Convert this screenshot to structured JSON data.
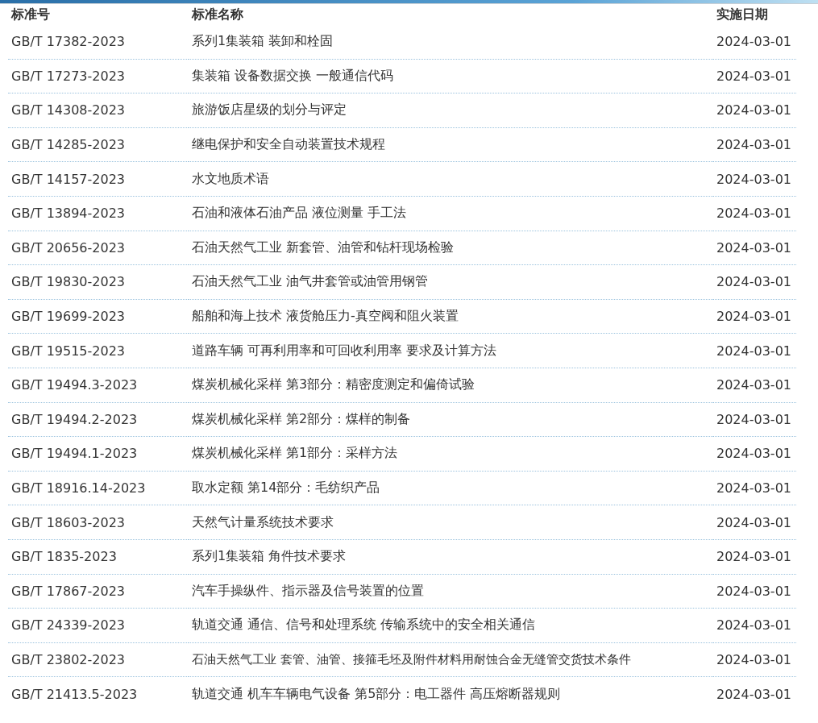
{
  "table": {
    "columns": [
      "标准号",
      "标准名称",
      "实施日期"
    ],
    "rows": [
      {
        "code": "GB/T 17382-2023",
        "name": "系列1集装箱 装卸和栓固",
        "date": "2024-03-01"
      },
      {
        "code": "GB/T 17273-2023",
        "name": "集装箱 设备数据交换 一般通信代码",
        "date": "2024-03-01"
      },
      {
        "code": "GB/T 14308-2023",
        "name": "旅游饭店星级的划分与评定",
        "date": "2024-03-01"
      },
      {
        "code": "GB/T 14285-2023",
        "name": "继电保护和安全自动装置技术规程",
        "date": "2024-03-01"
      },
      {
        "code": "GB/T 14157-2023",
        "name": "水文地质术语",
        "date": "2024-03-01"
      },
      {
        "code": "GB/T 13894-2023",
        "name": "石油和液体石油产品 液位测量 手工法",
        "date": "2024-03-01"
      },
      {
        "code": "GB/T 20656-2023",
        "name": "石油天然气工业 新套管、油管和钻杆现场检验",
        "date": "2024-03-01"
      },
      {
        "code": "GB/T 19830-2023",
        "name": "石油天然气工业 油气井套管或油管用钢管",
        "date": "2024-03-01"
      },
      {
        "code": "GB/T 19699-2023",
        "name": "船舶和海上技术 液货舱压力-真空阀和阻火装置",
        "date": "2024-03-01"
      },
      {
        "code": "GB/T 19515-2023",
        "name": "道路车辆 可再利用率和可回收利用率 要求及计算方法",
        "date": "2024-03-01"
      },
      {
        "code": "GB/T 19494.3-2023",
        "name": "煤炭机械化采样 第3部分：精密度测定和偏倚试验",
        "date": "2024-03-01"
      },
      {
        "code": "GB/T 19494.2-2023",
        "name": "煤炭机械化采样 第2部分：煤样的制备",
        "date": "2024-03-01"
      },
      {
        "code": "GB/T 19494.1-2023",
        "name": "煤炭机械化采样 第1部分：采样方法",
        "date": "2024-03-01"
      },
      {
        "code": "GB/T 18916.14-2023",
        "name": "取水定额 第14部分：毛纺织产品",
        "date": "2024-03-01"
      },
      {
        "code": "GB/T 18603-2023",
        "name": "天然气计量系统技术要求",
        "date": "2024-03-01"
      },
      {
        "code": "GB/T 1835-2023",
        "name": "系列1集装箱 角件技术要求",
        "date": "2024-03-01"
      },
      {
        "code": "GB/T 17867-2023",
        "name": "汽车手操纵件、指示器及信号装置的位置",
        "date": "2024-03-01"
      },
      {
        "code": "GB/T 24339-2023",
        "name": "轨道交通 通信、信号和处理系统 传输系统中的安全相关通信",
        "date": "2024-03-01"
      },
      {
        "code": "GB/T 23802-2023",
        "name": "石油天然气工业 套管、油管、接箍毛坯及附件材料用耐蚀合金无缝管交货技术条件",
        "date": "2024-03-01"
      },
      {
        "code": "GB/T 21413.5-2023",
        "name": "轨道交通 机车车辆电气设备 第5部分：电工器件 高压熔断器规则",
        "date": "2024-03-01"
      }
    ]
  }
}
